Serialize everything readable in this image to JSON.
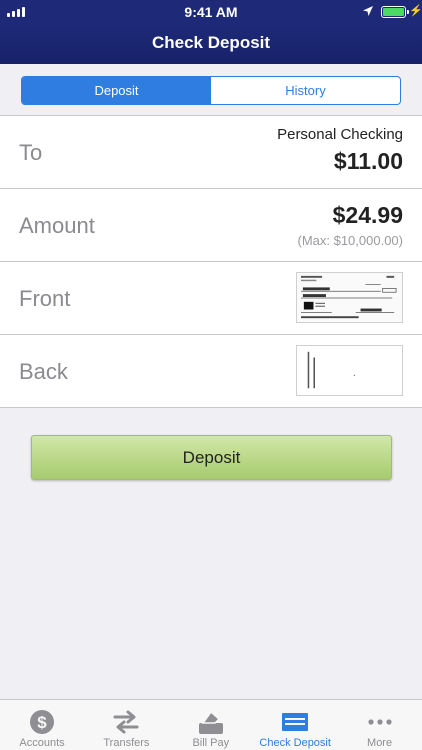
{
  "status_bar": {
    "time": "9:41 AM"
  },
  "nav": {
    "title": "Check Deposit"
  },
  "segments": [
    {
      "label": "Deposit",
      "active": true
    },
    {
      "label": "History",
      "active": false
    }
  ],
  "form": {
    "to": {
      "label": "To",
      "account": "Personal Checking",
      "amount": "$11.00"
    },
    "amount": {
      "label": "Amount",
      "value": "$24.99",
      "max": "(Max: $10,000.00)"
    },
    "front": {
      "label": "Front"
    },
    "back": {
      "label": "Back"
    }
  },
  "deposit_button": "Deposit",
  "tabs": [
    {
      "label": "Accounts",
      "icon": "dollar-coin-icon",
      "active": false
    },
    {
      "label": "Transfers",
      "icon": "transfer-arrows-icon",
      "active": false
    },
    {
      "label": "Bill Pay",
      "icon": "bill-pay-icon",
      "active": false
    },
    {
      "label": "Check Deposit",
      "icon": "check-deposit-icon",
      "active": true
    },
    {
      "label": "More",
      "icon": "more-dots-icon",
      "active": false
    }
  ],
  "colors": {
    "nav": "#1e2a78",
    "accent": "#2f7de1",
    "deposit_button": "#b7d785"
  }
}
